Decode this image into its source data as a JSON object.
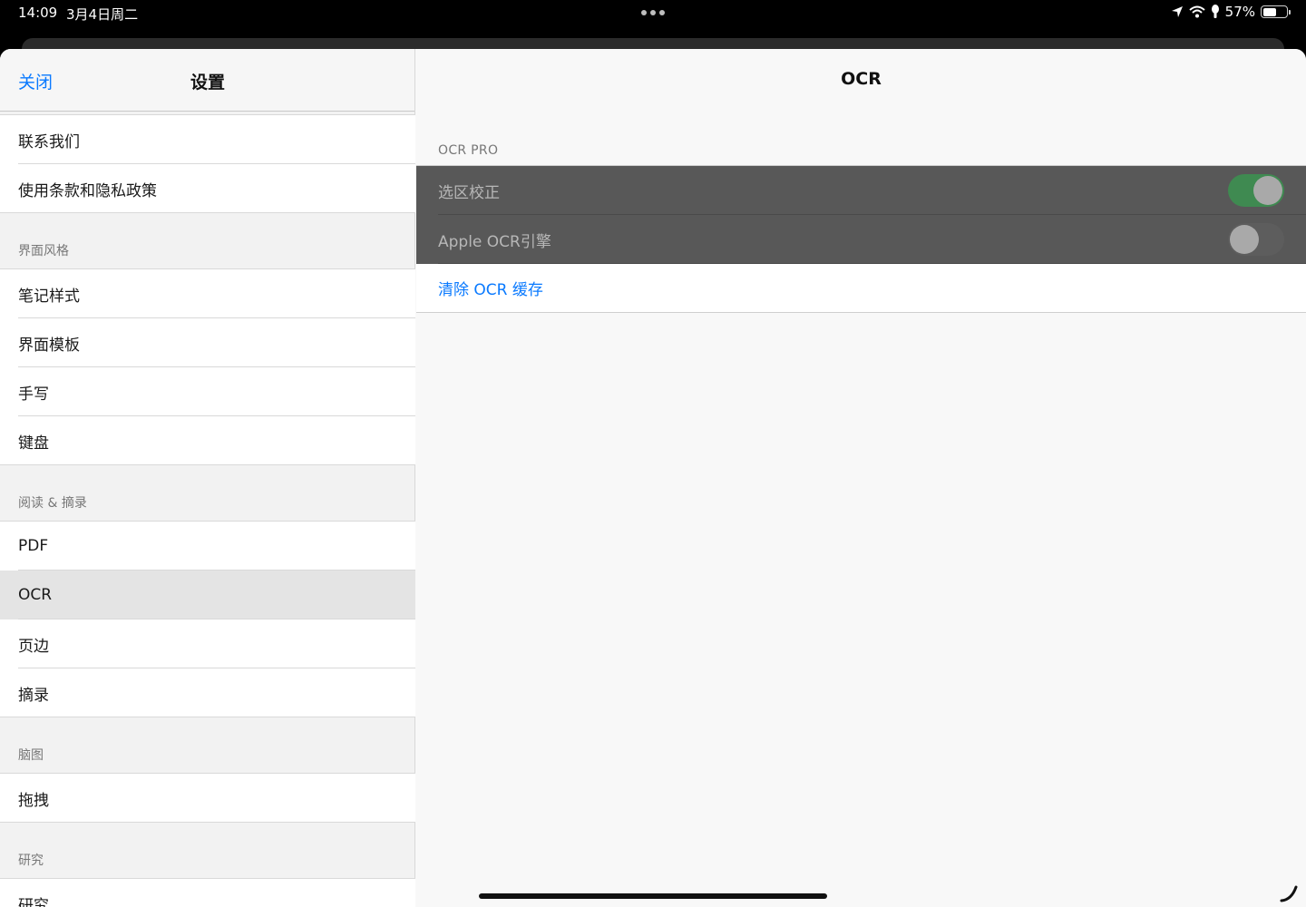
{
  "status_bar": {
    "time": "14:09",
    "date": "3月4日周二",
    "battery_percent": "57%",
    "battery_level": 0.57
  },
  "sidebar": {
    "close_label": "关闭",
    "title": "设置",
    "top_items": [
      "联系我们",
      "使用条款和隐私政策"
    ],
    "sections": [
      {
        "header": "界面风格",
        "items": [
          "笔记样式",
          "界面模板",
          "手写",
          "键盘"
        ]
      },
      {
        "header": "阅读 & 摘录",
        "items": [
          "PDF",
          "OCR",
          "页边",
          "摘录"
        ]
      },
      {
        "header": "脑图",
        "items": [
          "拖拽"
        ]
      },
      {
        "header": "研究",
        "items": [
          "研究"
        ]
      }
    ],
    "selected_item": "OCR"
  },
  "detail": {
    "title": "OCR",
    "section_header": "OCR PRO",
    "rows": [
      {
        "label": "选区校正",
        "toggle": true
      },
      {
        "label": "Apple OCR引擎",
        "toggle": false
      }
    ],
    "action_label": "清除 OCR 缓存"
  },
  "colors": {
    "accent": "#0a7aff",
    "toggle_on": "#3f8a51",
    "disabled_row": "#585858"
  },
  "icons": [
    "location-arrow-icon",
    "wifi-icon",
    "orientation-lock-icon",
    "battery-icon",
    "pencil-corner-icon"
  ]
}
